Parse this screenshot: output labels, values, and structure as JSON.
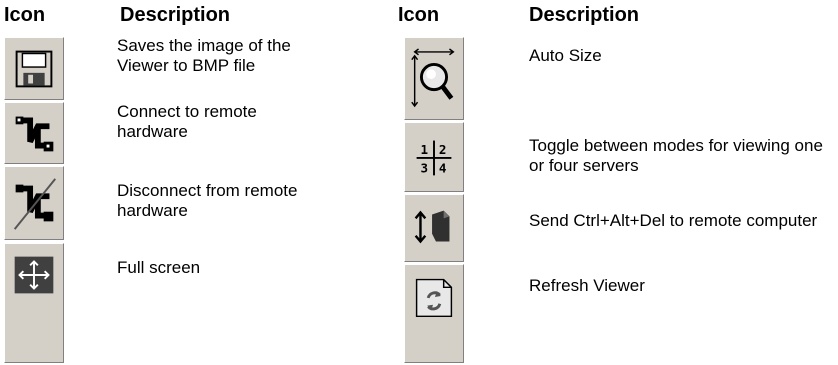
{
  "headers": {
    "left_icon": "Icon",
    "left_description": "Description",
    "right_icon": "Icon",
    "right_description": "Description"
  },
  "left_rows": [
    {
      "icon": "save-icon",
      "description": "Saves the image of the Viewer to BMP file"
    },
    {
      "icon": "connect-icon",
      "description": "Connect to remote hardware"
    },
    {
      "icon": "disconnect-icon",
      "description": "Disconnect from remote hardware"
    },
    {
      "icon": "full-screen-icon",
      "description": "Full screen"
    }
  ],
  "right_rows": [
    {
      "icon": "auto-size-icon",
      "description": "Auto Size"
    },
    {
      "icon": "toggle-modes-icon",
      "description": "Toggle between modes for viewing one or four servers"
    },
    {
      "icon": "ctrl-alt-del-icon",
      "description": "Send Ctrl+Alt+Del to remote computer"
    },
    {
      "icon": "refresh-icon",
      "description": "Refresh Viewer"
    }
  ]
}
